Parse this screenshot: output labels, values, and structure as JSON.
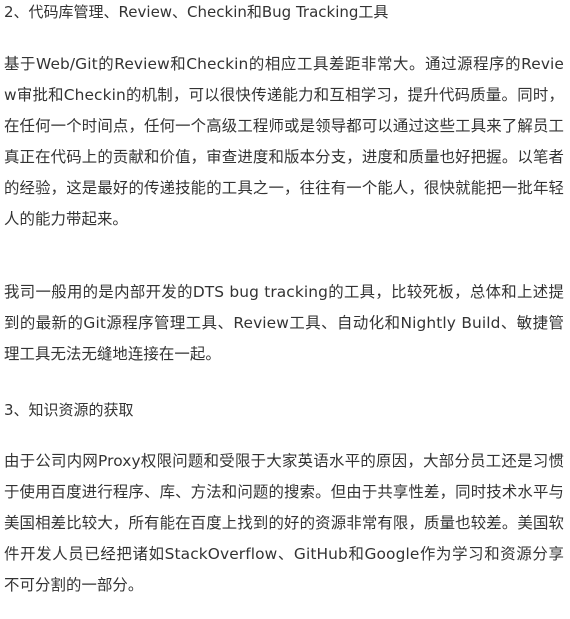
{
  "sections": {
    "heading_1": "2、代码库管理、Review、Checkin和Bug Tracking工具",
    "paragraph_1": "基于Web/Git的Review和Checkin的相应工具差距非常大。通过源程序的Review审批和Checkin的机制，可以很快传递能力和互相学习，提升代码质量。同时，在任何一个时间点，任何一个高级工程师或是领导都可以通过这些工具来了解员工真正在代码上的贡献和价值，审查进度和版本分支，进度和质量也好把握。以笔者的经验，这是最好的传递技能的工具之一，往往有一个能人，很快就能把一批年轻人的能力带起来。",
    "paragraph_2": "我司一般用的是内部开发的DTS bug tracking的工具，比较死板，总体和上述提到的最新的Git源程序管理工具、Review工具、自动化和Nightly Build、敏捷管理工具无法无缝地连接在一起。",
    "heading_2": "3、知识资源的获取",
    "paragraph_3": "由于公司内网Proxy权限问题和受限于大家英语水平的原因，大部分员工还是习惯于使用百度进行程序、库、方法和问题的搜索。但由于共享性差，同时技术水平与美国相差比较大，所有能在百度上找到的好的资源非常有限，质量也较差。美国软件开发人员已经把诸如StackOverflow、GitHub和Google作为学习和资源分享不可分割的一部分。"
  }
}
